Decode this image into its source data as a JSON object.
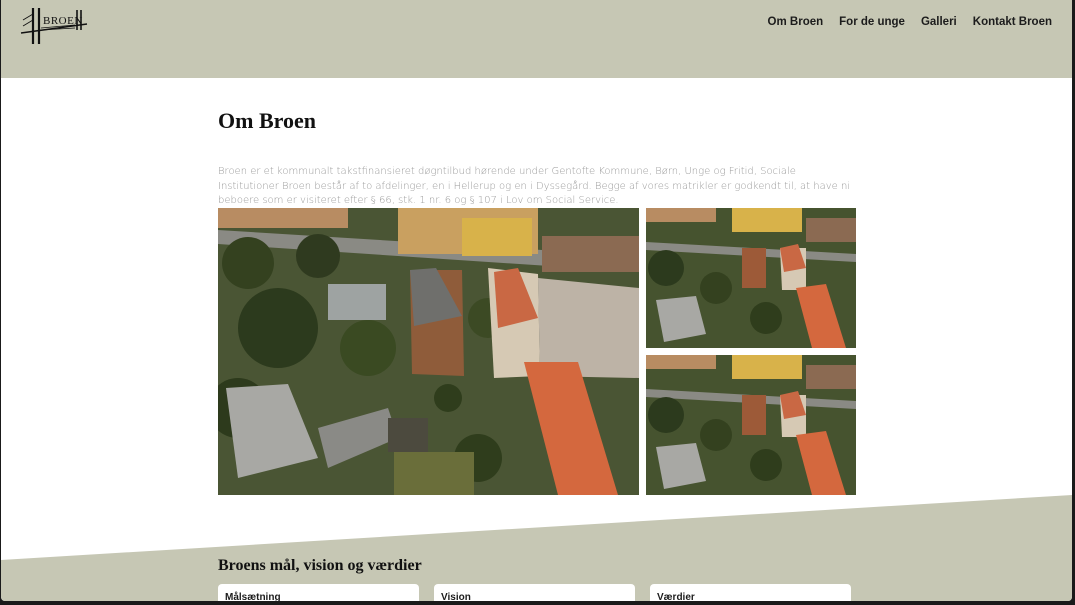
{
  "header": {
    "logo_text": "BROEN",
    "nav": [
      "Om Broen",
      "For de unge",
      "Galleri",
      "Kontakt Broen"
    ]
  },
  "main": {
    "title": "Om Broen",
    "intro_lines": [
      "Broen er et kommunalt takstfinansieret døgntilbud hørende under Gentofte Kommune, Børn, Unge og Fritid, Sociale",
      "Institutioner Broen består af to afdelinger, en i Hellerup og en i Dyssegård. Begge af vores matrikler er godkendt til, at have ni",
      "beboere som er visiteret efter § 66, stk. 1 nr. 6 og § 107 i Lov om Social Service."
    ]
  },
  "values_section": {
    "title": "Broens mål, vision og værdier",
    "cards": [
      "Målsætning",
      "Vision",
      "Værdier"
    ]
  },
  "colors": {
    "header_bg": "#c6c7b4",
    "section_bg": "#c6c7b4"
  }
}
